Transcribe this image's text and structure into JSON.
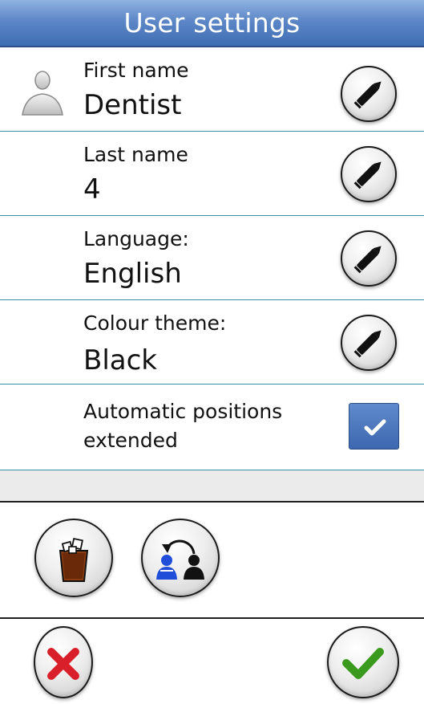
{
  "header": {
    "title": "User settings"
  },
  "rows": [
    {
      "label": "First name",
      "value": "Dentist",
      "icon": "pencil-icon"
    },
    {
      "label": "Last name",
      "value": "4",
      "icon": "pencil-icon"
    },
    {
      "label": "Language:",
      "value": "English",
      "icon": "pencil-icon"
    },
    {
      "label": "Colour theme:",
      "value": "Black",
      "icon": "pencil-icon"
    }
  ],
  "automatic_positions": {
    "label_line1": "Automatic positions",
    "label_line2": "extended",
    "checked": true
  },
  "icons": {
    "user": "user-avatar-icon",
    "delete": "trash-bin-icon",
    "switch_user": "switch-user-icon",
    "cancel": "red-x-icon",
    "confirm": "green-check-icon"
  },
  "colors": {
    "header": "#4f7bbd",
    "divider": "#3a8fa0",
    "checkbox": "#4a74ba",
    "cancel": "#d9202a",
    "confirm": "#3a9a1e",
    "trash": "#8a3d12",
    "switch_user_primary": "#1f4fd8"
  }
}
